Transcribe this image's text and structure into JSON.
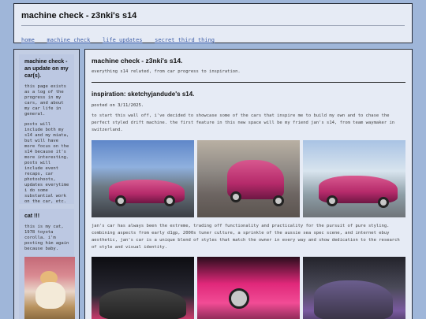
{
  "site": {
    "title": "machine check - z3nki's s14",
    "nav": [
      "home",
      "machine check",
      "life updates",
      "secret third thing"
    ]
  },
  "sidebar": {
    "about_title": "machine check - an update on my car(s).",
    "about_paragraphs": [
      "this page exists as a log of the progress in my cars, and about my car life in general.",
      "posts will include both my s14 and my miata, but will have more focus on the s14 because it's more interesting. posts will include event recaps, car photoshoots, updates everytime i do some substantial work on the car, etc."
    ],
    "cat_title": "cat !!!",
    "cat_text": "this is my cat, 1978 toyota corolla. i'm posting him again because baby."
  },
  "main": {
    "title": "machine check - z3nki's s14.",
    "tagline": "everything s14 related, from car progress to inspiration.",
    "post": {
      "title": "inspiration: sketchyjandude's s14.",
      "posted": "posted on 3/11/2025.",
      "intro": "to start this wall off, i've decided to showcase some of the cars that inspire me to build my own and to chase the perfect styled drift machine. the first feature in this new space will be my friend jan's s14, from team waymaker in switzerland.",
      "body": "jan's car has always been the extreme, trading off functionality and practicality for the pursuit of pure styling. combining aspects from early d1gp, 2000s tuner culture, a sprinkle of the aussie sea spec scene, and internet ebuy aesthetic, jan's car is a unique blend of styles that match the owner in every way and show dedication to the research of style and visual identity."
    }
  }
}
